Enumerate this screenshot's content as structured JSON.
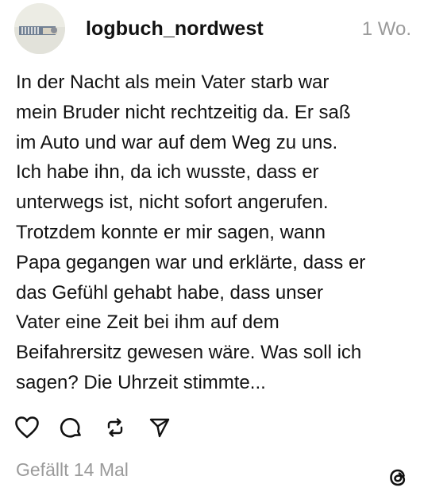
{
  "post": {
    "username": "logbuch_nordwest",
    "timestamp": "1 Wo.",
    "text": "In der Nacht als mein Vater starb war\nmein Bruder nicht rechtzeitig da. Er saß\nim Auto und war auf dem Weg zu uns.\nIch habe ihn, da ich wusste, dass er\nunterwegs ist, nicht sofort angerufen.\nTrotzdem konnte er mir sagen, wann\nPapa gegangen war und erklärte, dass er\ndas Gefühl gehabt habe, dass unser\nVater eine Zeit bei ihm auf dem\nBeifahrersitz gewesen wäre. Was soll ich\nsagen? Die Uhrzeit stimmte...",
    "likes_text": "Gefällt 14 Mal"
  },
  "icons": {
    "like": "heart-icon",
    "comment": "comment-bubble-icon",
    "repost": "repost-arrows-icon",
    "share": "send-paper-plane-icon",
    "brand": "threads-logo-icon"
  },
  "colors": {
    "text": "#121212",
    "muted": "#9a9a9a",
    "background": "#ffffff"
  }
}
